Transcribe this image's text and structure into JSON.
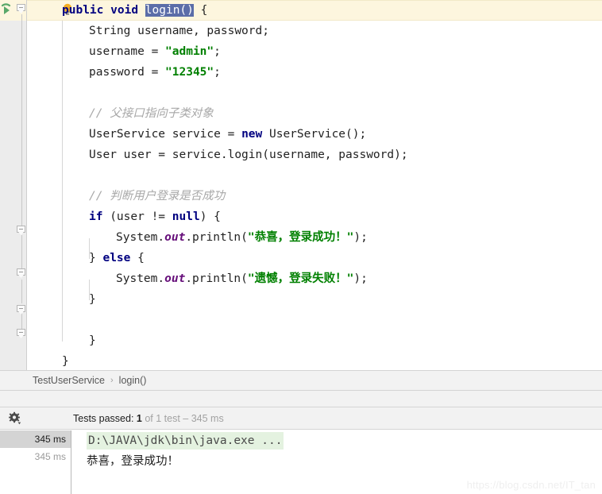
{
  "editor": {
    "current_line_index": 0,
    "gutter": {
      "run_icon": "run-arrow-icon",
      "lightbulb_icon": "lightbulb-icon",
      "fold_icon": "fold-minus-icon"
    },
    "lines": [
      {
        "indent": 0,
        "tokens": [
          {
            "t": "public",
            "c": "kw"
          },
          {
            "t": " ",
            "c": "plain"
          },
          {
            "t": "void",
            "c": "kw"
          },
          {
            "t": " ",
            "c": "plain"
          },
          {
            "t": "login()",
            "c": "sel"
          },
          {
            "t": " {",
            "c": "plain"
          }
        ]
      },
      {
        "indent": 1,
        "tokens": [
          {
            "t": "String username, password;",
            "c": "plain"
          }
        ]
      },
      {
        "indent": 1,
        "tokens": [
          {
            "t": "username = ",
            "c": "plain"
          },
          {
            "t": "\"admin\"",
            "c": "str"
          },
          {
            "t": ";",
            "c": "plain"
          }
        ]
      },
      {
        "indent": 1,
        "tokens": [
          {
            "t": "password = ",
            "c": "plain"
          },
          {
            "t": "\"12345\"",
            "c": "str"
          },
          {
            "t": ";",
            "c": "plain"
          }
        ]
      },
      {
        "indent": 0,
        "tokens": []
      },
      {
        "indent": 1,
        "tokens": [
          {
            "t": "// 父接口指向子类对象",
            "c": "cmt"
          }
        ]
      },
      {
        "indent": 1,
        "tokens": [
          {
            "t": "UserService service = ",
            "c": "plain"
          },
          {
            "t": "new",
            "c": "kw"
          },
          {
            "t": " UserService();",
            "c": "plain"
          }
        ]
      },
      {
        "indent": 1,
        "tokens": [
          {
            "t": "User user = service.login(username, password);",
            "c": "plain"
          }
        ]
      },
      {
        "indent": 0,
        "tokens": []
      },
      {
        "indent": 1,
        "tokens": [
          {
            "t": "// 判断用户登录是否成功",
            "c": "cmt"
          }
        ]
      },
      {
        "indent": 1,
        "tokens": [
          {
            "t": "if",
            "c": "kw"
          },
          {
            "t": " (user != ",
            "c": "plain"
          },
          {
            "t": "null",
            "c": "kw"
          },
          {
            "t": ") {",
            "c": "plain"
          }
        ]
      },
      {
        "indent": 2,
        "tokens": [
          {
            "t": "System.",
            "c": "plain"
          },
          {
            "t": "out",
            "c": "fld"
          },
          {
            "t": ".println(",
            "c": "plain"
          },
          {
            "t": "\"恭喜，登录成功！\"",
            "c": "str"
          },
          {
            "t": ");",
            "c": "plain"
          }
        ]
      },
      {
        "indent": 1,
        "tokens": [
          {
            "t": "} ",
            "c": "plain"
          },
          {
            "t": "else",
            "c": "kw"
          },
          {
            "t": " {",
            "c": "plain"
          }
        ]
      },
      {
        "indent": 2,
        "tokens": [
          {
            "t": "System.",
            "c": "plain"
          },
          {
            "t": "out",
            "c": "fld"
          },
          {
            "t": ".println(",
            "c": "plain"
          },
          {
            "t": "\"遗憾，登录失败！\"",
            "c": "str"
          },
          {
            "t": ");",
            "c": "plain"
          }
        ]
      },
      {
        "indent": 1,
        "tokens": [
          {
            "t": "}",
            "c": "plain"
          }
        ]
      },
      {
        "indent": 0,
        "tokens": []
      },
      {
        "indent": 1,
        "tokens": [
          {
            "t": "}",
            "c": "plain"
          }
        ]
      },
      {
        "indent": 0,
        "tokens": [
          {
            "t": "}",
            "c": "plain"
          }
        ]
      }
    ]
  },
  "breadcrumb": {
    "class_name": "TestUserService",
    "separator": "›",
    "method_name": "login()"
  },
  "test_runner": {
    "gear_icon": "gear-icon",
    "status": {
      "passed_label": "Tests passed: ",
      "passed_count": "1",
      "detail": " of 1 test – 345 ms"
    },
    "timings": [
      {
        "value": "345 ms",
        "selected": true
      },
      {
        "value": "345 ms",
        "selected": false
      }
    ],
    "console": {
      "command_line": "D:\\JAVA\\jdk\\bin\\java.exe ...",
      "output_line": "恭喜，登录成功！"
    }
  },
  "watermark": {
    "text": "https://blog.csdn.net/IT_tan"
  },
  "colors": {
    "keyword": "#000080",
    "string": "#008000",
    "comment": "#a8a8a8",
    "field": "#660e7a",
    "selection": "#5b6da8",
    "current_line": "#fdf6de",
    "gutter": "#ececec",
    "console_highlight": "#e4f2e0"
  }
}
